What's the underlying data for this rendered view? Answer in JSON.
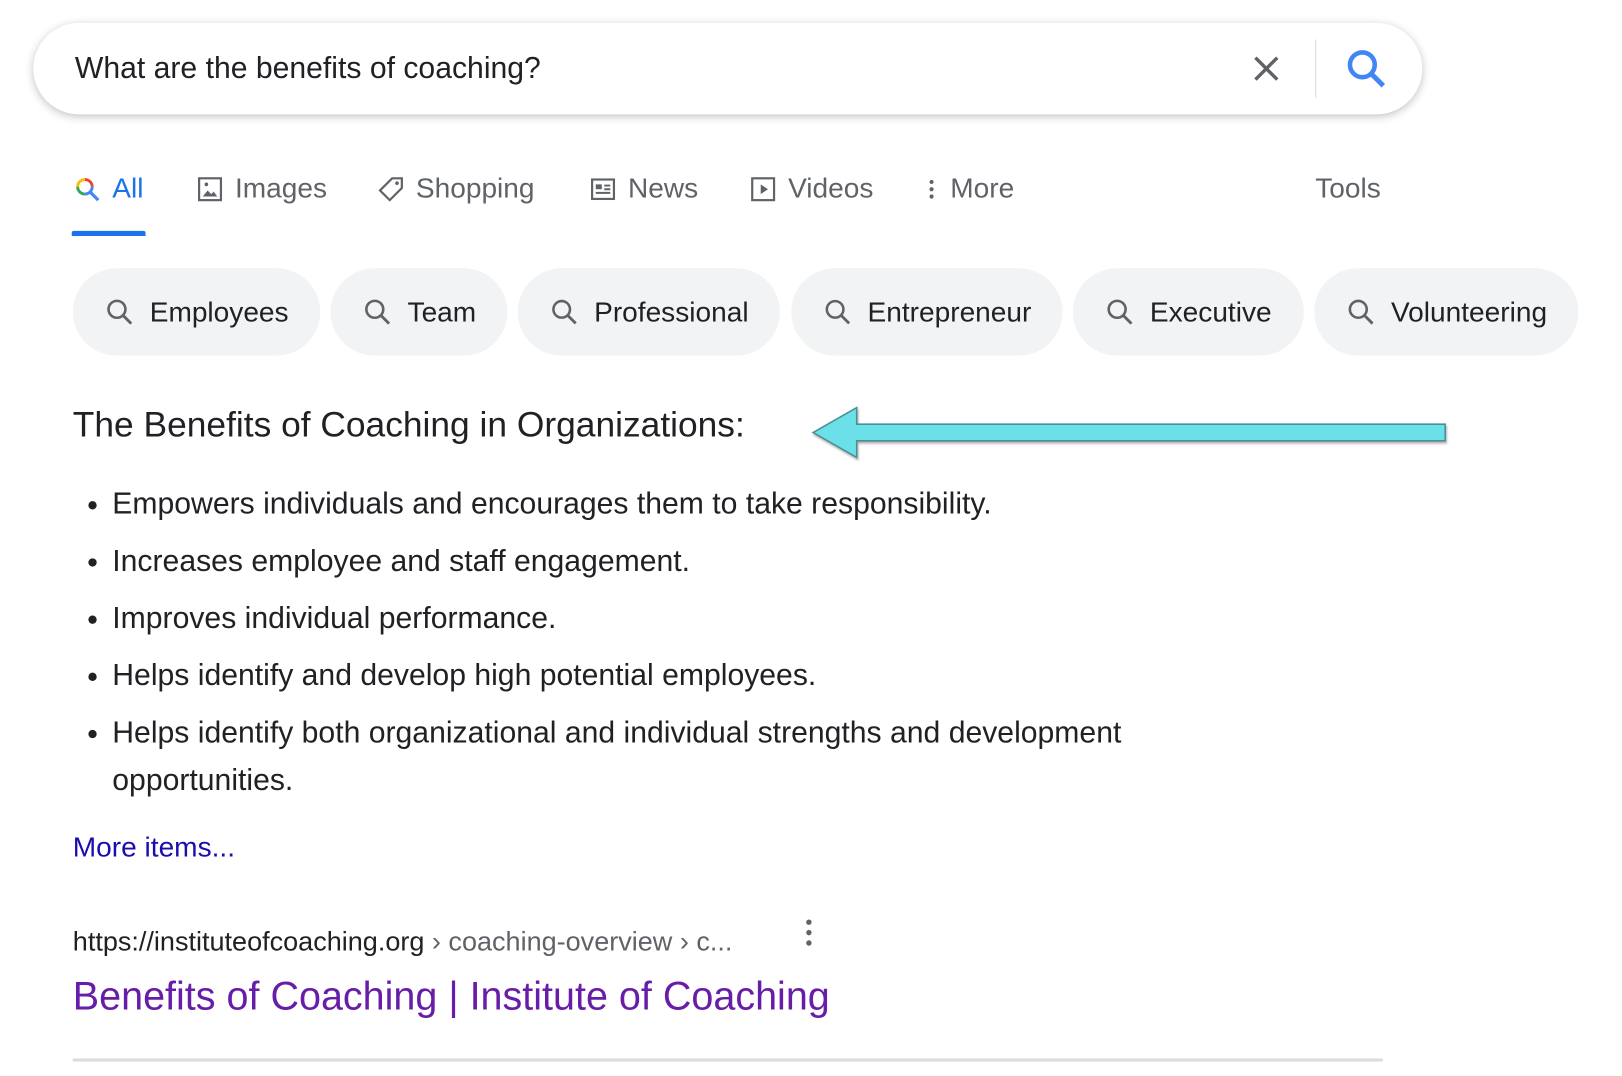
{
  "search": {
    "query": "What are the benefits of coaching?",
    "clear_icon": "close-icon",
    "search_icon": "search-icon",
    "accent": "#1a73e8"
  },
  "tabs": [
    {
      "label": "All",
      "icon": "search-multicolor-icon",
      "active": true
    },
    {
      "label": "Images",
      "icon": "image-icon"
    },
    {
      "label": "Shopping",
      "icon": "tag-icon"
    },
    {
      "label": "News",
      "icon": "newspaper-icon"
    },
    {
      "label": "Videos",
      "icon": "play-icon"
    },
    {
      "label": "More",
      "icon": "vertical-dots-icon"
    }
  ],
  "tools_label": "Tools",
  "chips": [
    "Employees",
    "Team",
    "Professional",
    "Entrepreneur",
    "Executive",
    "Volunteering"
  ],
  "snippet": {
    "heading": "The Benefits of Coaching in Organizations:",
    "annotation_arrow_color": "#6ce0e8",
    "items": [
      "Empowers individuals and encourages them to take responsibility.",
      "Increases employee and staff engagement.",
      "Improves individual performance.",
      "Helps identify and develop high potential employees.",
      "Helps identify both organizational and individual strengths and development opportunities."
    ],
    "more_link": "More items..."
  },
  "result": {
    "url_domain": "https://instituteofcoaching.org",
    "url_path": " › coaching-overview › c...",
    "title": "Benefits of Coaching | Institute of Coaching",
    "title_color": "#681da8"
  }
}
